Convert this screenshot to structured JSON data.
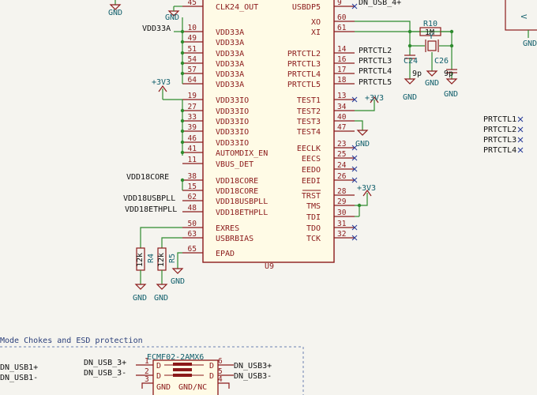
{
  "chip": {
    "ref": "U9",
    "left_pins": [
      {
        "num": "45",
        "name": "CLK24_OUT"
      },
      {
        "num": "10",
        "name": "VDD33A"
      },
      {
        "num": "49",
        "name": "VDD33A"
      },
      {
        "num": "51",
        "name": "VDD33A"
      },
      {
        "num": "54",
        "name": "VDD33A"
      },
      {
        "num": "57",
        "name": "VDD33A"
      },
      {
        "num": "64",
        "name": "VDD33A"
      },
      {
        "num": "19",
        "name": "VDD33IO"
      },
      {
        "num": "27",
        "name": "VDD33IO"
      },
      {
        "num": "33",
        "name": "VDD33IO"
      },
      {
        "num": "39",
        "name": "VDD33IO"
      },
      {
        "num": "46",
        "name": "VDD33IO"
      },
      {
        "num": "41",
        "name": "AUTOMDIX_EN"
      },
      {
        "num": "11",
        "name": "VBUS_DET"
      },
      {
        "num": "38",
        "name": "VDD18CORE"
      },
      {
        "num": "15",
        "name": "VDD18CORE"
      },
      {
        "num": "62",
        "name": "VDD18USBPLL"
      },
      {
        "num": "48",
        "name": "VDD18ETHPLL"
      },
      {
        "num": "50",
        "name": "EXRES"
      },
      {
        "num": "63",
        "name": "USBRBIAS"
      },
      {
        "num": "65",
        "name": "EPAD"
      }
    ],
    "right_pins": [
      {
        "num": "9",
        "name": "USBDP5"
      },
      {
        "num": "60",
        "name": "XO"
      },
      {
        "num": "61",
        "name": "XI"
      },
      {
        "num": "14",
        "name": "PRTCTL2"
      },
      {
        "num": "16",
        "name": "PRTCTL3"
      },
      {
        "num": "17",
        "name": "PRTCTL4"
      },
      {
        "num": "18",
        "name": "PRTCTL5"
      },
      {
        "num": "13",
        "name": "TEST1"
      },
      {
        "num": "34",
        "name": "TEST2"
      },
      {
        "num": "40",
        "name": "TEST3"
      },
      {
        "num": "47",
        "name": "TEST4"
      },
      {
        "num": "23",
        "name": "EECLK"
      },
      {
        "num": "25",
        "name": "EECS"
      },
      {
        "num": "24",
        "name": "EEDO"
      },
      {
        "num": "26",
        "name": "EEDI"
      },
      {
        "num": "28",
        "name": "TRST"
      },
      {
        "num": "29",
        "name": "TMS"
      },
      {
        "num": "30",
        "name": "TDI"
      },
      {
        "num": "31",
        "name": "TDO"
      },
      {
        "num": "32",
        "name": "TCK"
      }
    ]
  },
  "nets": {
    "vdd33a": "VDD33A",
    "vdd18core": "VDD18CORE",
    "vdd18usbpll": "VDD18USBPLL",
    "vdd18ethpll": "VDD18ETHPLL",
    "dn_usb_4p": "DN_USB_4+",
    "prtctl2": "PRTCTL2",
    "prtctl3": "PRTCTL3",
    "prtctl4": "PRTCTL4",
    "prtctl5": "PRTCTL5",
    "list": [
      "PRTCTL1",
      "PRTCTL2",
      "PRTCTL3",
      "PRTCTL4"
    ]
  },
  "power": {
    "v33": "+3V3",
    "gnd": "GND",
    "v_cut": "V"
  },
  "crystal": {
    "r_ref": "R10",
    "r_val": "1M",
    "y_ref": "Y",
    "c1_ref": "C24",
    "c1_val": "9p",
    "c2_ref": "C26",
    "c2_val": "9p"
  },
  "resistors": {
    "r4_ref": "R4",
    "r4_val": "12k",
    "r5_ref": "R5",
    "r5_val": "12k"
  },
  "esd": {
    "title": "Mode Chokes and ESD protection",
    "part": "ECMF02-2AMX6",
    "left_nets": [
      "DN_USB1+",
      "DN_USB1-"
    ],
    "in_nets": [
      "DN_USB_3+",
      "DN_USB_3-"
    ],
    "out_nets": [
      "DN_USB3+",
      "DN_USB3-"
    ],
    "pin_l1": "1",
    "pin_l2": "2",
    "pin_l3": "3",
    "pin_r6": "6",
    "pin_r5": "5",
    "pin_r4": "4",
    "d": "D",
    "gnd_label": "GND",
    "gnd_nc": "GND/NC"
  }
}
